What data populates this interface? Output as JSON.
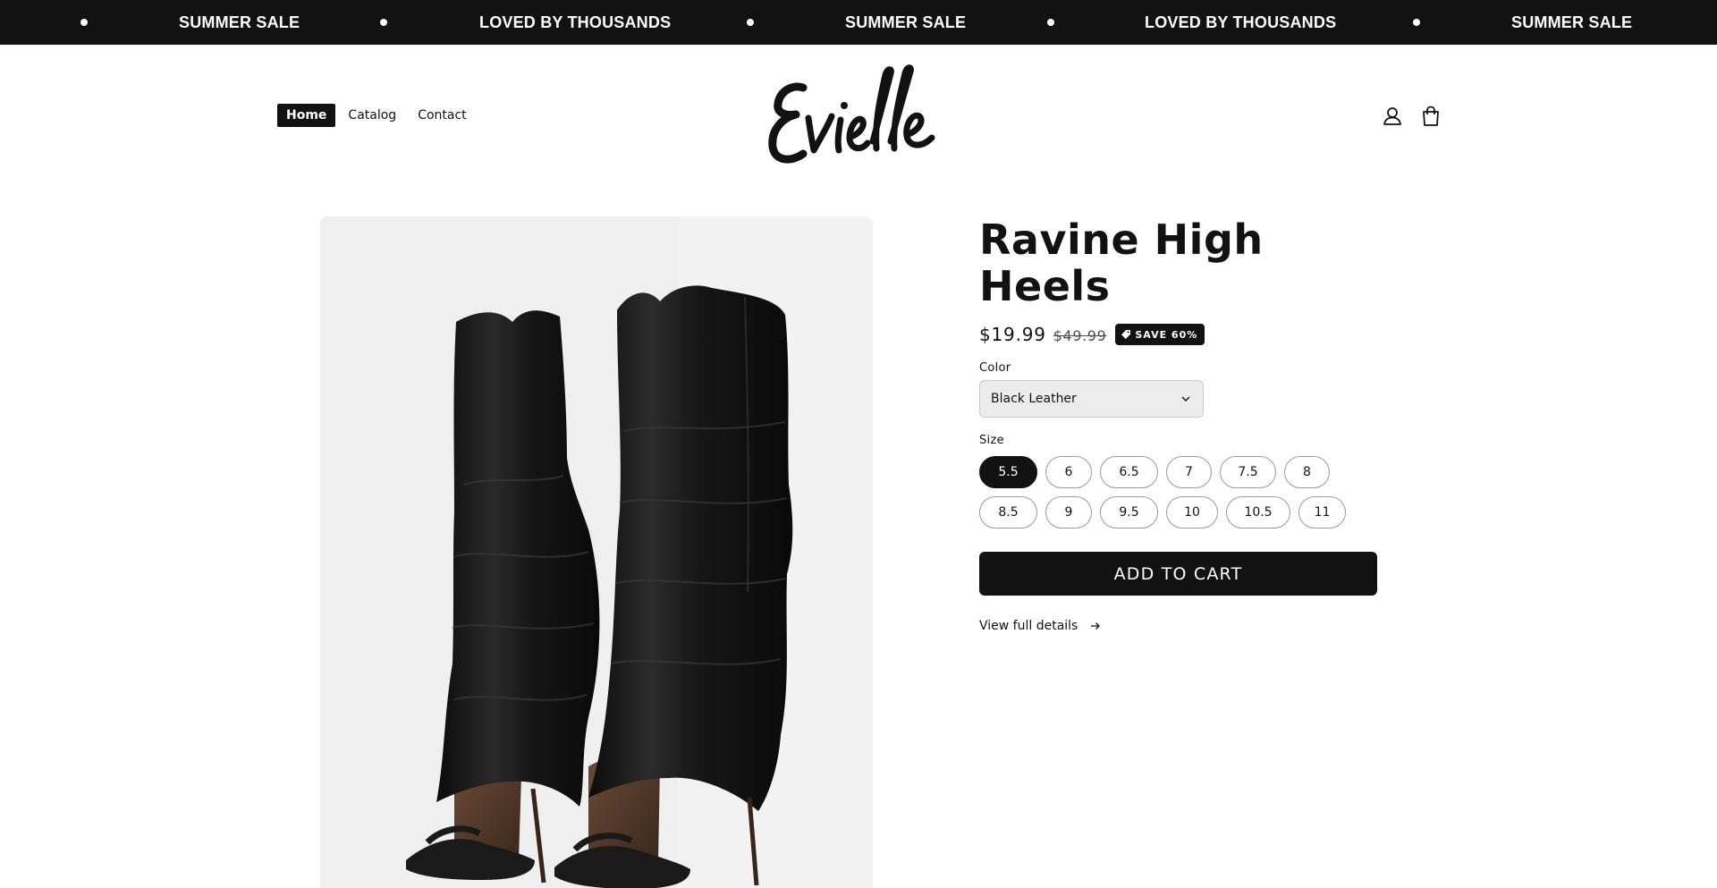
{
  "announcement": {
    "items": [
      "SUMMER SALE",
      "LOVED BY THOUSANDS",
      "SUMMER SALE",
      "LOVED BY THOUSANDS",
      "SUMMER SALE"
    ],
    "background": "#121212",
    "text_color": "#ffffff"
  },
  "header": {
    "nav": [
      {
        "label": "Home",
        "active": true
      },
      {
        "label": "Catalog",
        "active": false
      },
      {
        "label": "Contact",
        "active": false
      }
    ],
    "logo_text": "Evielle",
    "icons": [
      "account-icon",
      "cart-icon"
    ]
  },
  "product": {
    "title": "Ravine High Heels",
    "price_sale": "$19.99",
    "price_regular": "$49.99",
    "badge": "SAVE 60%",
    "color_label": "Color",
    "color_value": "Black Leather",
    "size_label": "Size",
    "sizes": [
      "5.5",
      "6",
      "6.5",
      "7",
      "7.5",
      "8",
      "8.5",
      "9",
      "9.5",
      "10",
      "10.5",
      "11"
    ],
    "selected_size": "5.5",
    "add_to_cart": "ADD TO CART",
    "details_link": "View full details",
    "image_alt": "black leather knee-high slouch sandal boots"
  },
  "colors": {
    "primary": "#121212",
    "media_bg": "#efefef",
    "select_bg": "#ececec"
  }
}
